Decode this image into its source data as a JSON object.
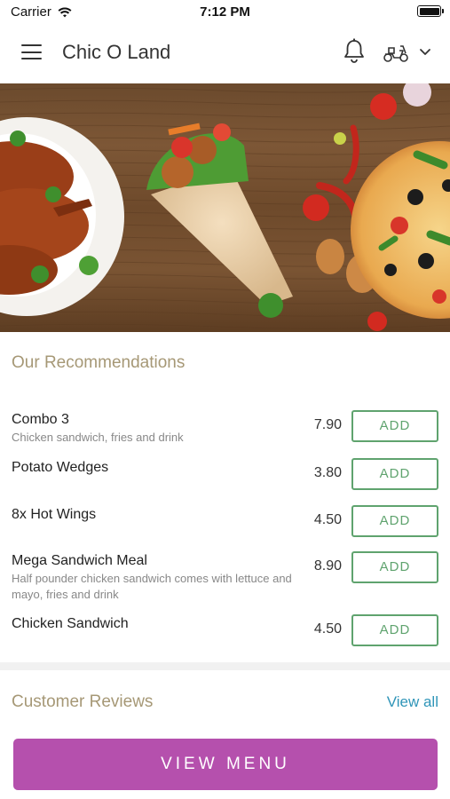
{
  "status_bar": {
    "carrier": "Carrier",
    "time": "7:12 PM",
    "icons": [
      "wifi-icon",
      "battery-icon"
    ]
  },
  "header": {
    "title": "Chic O Land",
    "icons": [
      "menu-icon",
      "bell-icon",
      "delivery-scooter-icon",
      "chevron-down-icon"
    ]
  },
  "hero": {
    "image": "food-banner",
    "depicts": [
      "roast-chicken",
      "wrap",
      "pizza",
      "tomatoes",
      "onions",
      "chilies"
    ]
  },
  "recommendations": {
    "title": "Our Recommendations",
    "add_label": "ADD",
    "items": [
      {
        "name": "Combo 3",
        "description": "Chicken sandwich, fries and drink",
        "price": "7.90"
      },
      {
        "name": "Potato Wedges",
        "description": "",
        "price": "3.80"
      },
      {
        "name": "8x Hot Wings",
        "description": "",
        "price": "4.50"
      },
      {
        "name": "Mega Sandwich Meal",
        "description": "Half pounder chicken sandwich comes with lettuce and mayo, fries and drink",
        "price": "8.90"
      },
      {
        "name": "Chicken Sandwich",
        "description": "",
        "price": "4.50"
      }
    ]
  },
  "reviews": {
    "title": "Customer Reviews",
    "view_all_label": "View all"
  },
  "footer": {
    "view_menu_label": "VIEW MENU"
  },
  "colors": {
    "accent_gold": "#a69876",
    "add_green": "#5fa36e",
    "link_blue": "#2f95b8",
    "menu_button_purple": "#b550ad"
  }
}
